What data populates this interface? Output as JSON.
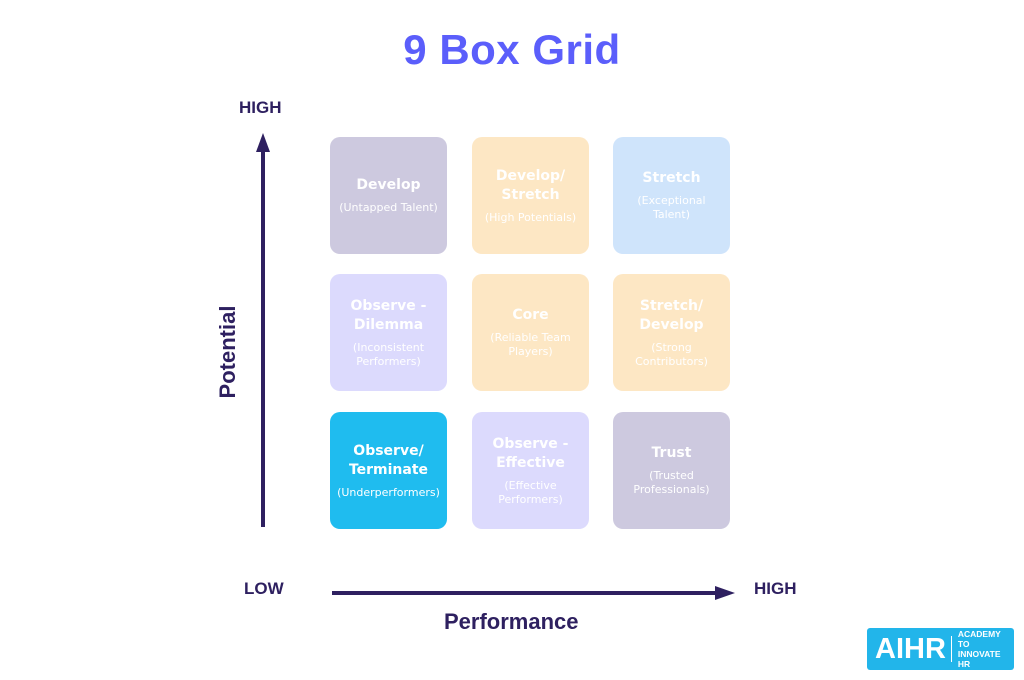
{
  "title": "9 Box Grid",
  "axes": {
    "y": {
      "title": "Potential",
      "high_label": "HIGH"
    },
    "x": {
      "title": "Performance",
      "low_label": "LOW",
      "high_label": "HIGH"
    },
    "color": "#2e2060"
  },
  "grid": [
    {
      "row": "high-potential",
      "col": "low-performance",
      "name": "Develop",
      "desc": "(Untapped Talent)",
      "color": "#cdc9df"
    },
    {
      "row": "high-potential",
      "col": "mid-performance",
      "name": "Develop/ Stretch",
      "desc": "(High Potentials)",
      "color": "#fde7c4"
    },
    {
      "row": "high-potential",
      "col": "high-performance",
      "name": "Stretch",
      "desc": "(Exceptional Talent)",
      "color": "#cfe4fb"
    },
    {
      "row": "mid-potential",
      "col": "low-performance",
      "name": "Observe - Dilemma",
      "desc": "(Inconsistent Performers)",
      "color": "#dcdafd"
    },
    {
      "row": "mid-potential",
      "col": "mid-performance",
      "name": "Core",
      "desc": "(Reliable Team Players)",
      "color": "#fde7c4"
    },
    {
      "row": "mid-potential",
      "col": "high-performance",
      "name": "Stretch/ Develop",
      "desc": "(Strong Contributors)",
      "color": "#fde7c4"
    },
    {
      "row": "low-potential",
      "col": "low-performance",
      "name": "Observe/ Terminate",
      "desc": "(Underperformers)",
      "color": "#1fbcef"
    },
    {
      "row": "low-potential",
      "col": "mid-performance",
      "name": "Observe - Effective",
      "desc": "(Effective Performers)",
      "color": "#dcdafd"
    },
    {
      "row": "low-potential",
      "col": "high-performance",
      "name": "Trust",
      "desc": "(Trusted Professionals)",
      "color": "#cdc9df"
    }
  ],
  "logo": {
    "mark": "AIHR",
    "tagline_line1": "ACADEMY TO",
    "tagline_line2": "INNOVATE HR",
    "color": "#22b5ea"
  }
}
